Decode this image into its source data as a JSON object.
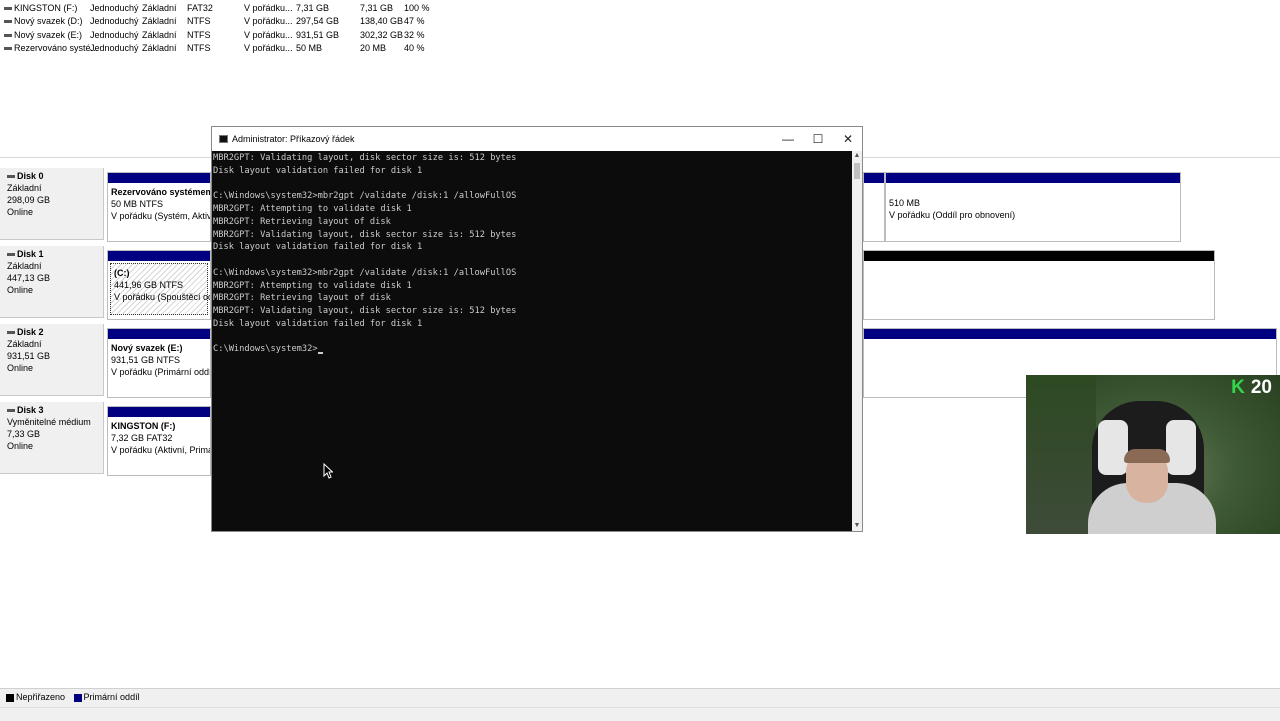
{
  "volumes": [
    {
      "name": "KINGSTON (F:)",
      "layout": "Jednoduchý",
      "type": "Základní",
      "fs": "FAT32",
      "status": "V pořádku...",
      "capacity": "7,31 GB",
      "free": "7,31 GB",
      "pct": "100 %"
    },
    {
      "name": "Nový svazek (D:)",
      "layout": "Jednoduchý",
      "type": "Základní",
      "fs": "NTFS",
      "status": "V pořádku...",
      "capacity": "297,54 GB",
      "free": "138,40 GB",
      "pct": "47 %"
    },
    {
      "name": "Nový svazek (E:)",
      "layout": "Jednoduchý",
      "type": "Základní",
      "fs": "NTFS",
      "status": "V pořádku...",
      "capacity": "931,51 GB",
      "free": "302,32 GB",
      "pct": "32 %"
    },
    {
      "name": "Rezervováno systé...",
      "layout": "Jednoduchý",
      "type": "Základní",
      "fs": "NTFS",
      "status": "V pořádku...",
      "capacity": "50 MB",
      "free": "20 MB",
      "pct": "40 %"
    }
  ],
  "disks": [
    {
      "name": "Disk 0",
      "kind": "Základní",
      "size": "298,09 GB",
      "state": "Online",
      "p1": {
        "title": "Rezervováno systémem",
        "size": "50 MB NTFS",
        "status": "V pořádku (Systém, Aktivní,"
      },
      "p2": {
        "size": "510 MB",
        "status": "V pořádku (Oddíl pro obnovení)"
      }
    },
    {
      "name": "Disk 1",
      "kind": "Základní",
      "size": "447,13 GB",
      "state": "Online",
      "p1": {
        "title": "(C:)",
        "size": "441,96 GB NTFS",
        "status": "V pořádku (Spouštěcí oddíl,"
      }
    },
    {
      "name": "Disk 2",
      "kind": "Základní",
      "size": "931,51 GB",
      "state": "Online",
      "p1": {
        "title": "Nový svazek  (E:)",
        "size": "931,51 GB NTFS",
        "status": "V pořádku (Primární oddíl)"
      }
    },
    {
      "name": "Disk 3",
      "kind": "Vyměnitelné médium",
      "size": "7,33 GB",
      "state": "Online",
      "p1": {
        "title": "KINGSTON  (F:)",
        "size": "7,32 GB FAT32",
        "status": "V pořádku (Aktivní, Primární"
      }
    }
  ],
  "legend": {
    "unallocated": "Nepřiřazeno",
    "primary": "Primární oddíl"
  },
  "cmd": {
    "title": "Administrator: Příkazový řádek",
    "lines": [
      "MBR2GPT: Validating layout, disk sector size is: 512 bytes",
      "Disk layout validation failed for disk 1",
      "",
      "C:\\Windows\\system32>mbr2gpt /validate /disk:1 /allowFullOS",
      "MBR2GPT: Attempting to validate disk 1",
      "MBR2GPT: Retrieving layout of disk",
      "MBR2GPT: Validating layout, disk sector size is: 512 bytes",
      "Disk layout validation failed for disk 1",
      "",
      "C:\\Windows\\system32>mbr2gpt /validate /disk:1 /allowFullOS",
      "MBR2GPT: Attempting to validate disk 1",
      "MBR2GPT: Retrieving layout of disk",
      "MBR2GPT: Validating layout, disk sector size is: 512 bytes",
      "Disk layout validation failed for disk 1",
      ""
    ],
    "prompt": "C:\\Windows\\system32>"
  },
  "webcam": {
    "badge_number": "20"
  },
  "colors": {
    "primary_partition": "#000080",
    "unallocated": "#000000",
    "console_bg": "#0c0c0c",
    "console_fg": "#cccccc"
  },
  "icons": {
    "minimize": "minimize-icon",
    "maximize": "maximize-icon",
    "close": "close-icon",
    "cmd": "cmd-app-icon",
    "disk": "disk-icon"
  }
}
